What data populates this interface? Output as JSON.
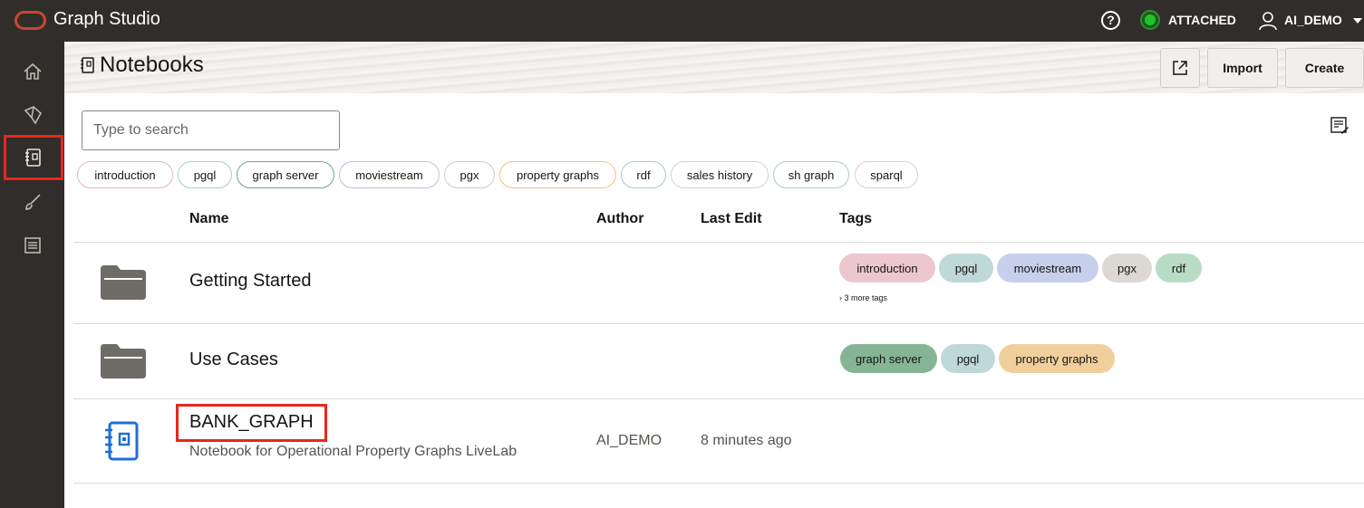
{
  "app": {
    "title": "Graph Studio"
  },
  "topbar": {
    "help_icon": "help-icon",
    "status": "ATTACHED",
    "status_color": "#22c22e",
    "user": "AI_DEMO"
  },
  "sidebar": {
    "items": [
      {
        "icon": "home-icon"
      },
      {
        "icon": "graph-icon"
      },
      {
        "icon": "notebook-icon",
        "active": true
      },
      {
        "icon": "brush-icon"
      },
      {
        "icon": "jobs-list-icon"
      }
    ]
  },
  "header": {
    "title": "Notebooks",
    "import_label": "Import",
    "create_label": "Create"
  },
  "search": {
    "placeholder": "Type to search"
  },
  "filter_tags": [
    "introduction",
    "pgql",
    "graph server",
    "moviestream",
    "pgx",
    "property graphs",
    "rdf",
    "sales history",
    "sh graph",
    "sparql"
  ],
  "table": {
    "headers": {
      "name": "Name",
      "author": "Author",
      "last_edit": "Last Edit",
      "tags": "Tags"
    },
    "rows": [
      {
        "type": "folder",
        "name": "Getting Started",
        "tags": [
          "introduction",
          "pgql",
          "moviestream",
          "pgx",
          "rdf"
        ],
        "more_tags": "3 more tags"
      },
      {
        "type": "folder",
        "name": "Use Cases",
        "tags": [
          "graph server",
          "pgql",
          "property graphs"
        ]
      },
      {
        "type": "notebook",
        "name": "BANK_GRAPH",
        "description": "Notebook for Operational Property Graphs LiveLab",
        "author": "AI_DEMO",
        "last_edit": "8 minutes ago"
      }
    ]
  },
  "colors": {
    "accent_red": "#e5281c",
    "tag_introduction": "#ecc7cf",
    "tag_pgql": "#bfd8d8",
    "tag_moviestream": "#c6cfec",
    "tag_pgx": "#dcd8d4",
    "tag_rdf": "#b9dcc4",
    "tag_graph_server": "#86b596",
    "tag_property_graphs": "#f1cf9c"
  }
}
